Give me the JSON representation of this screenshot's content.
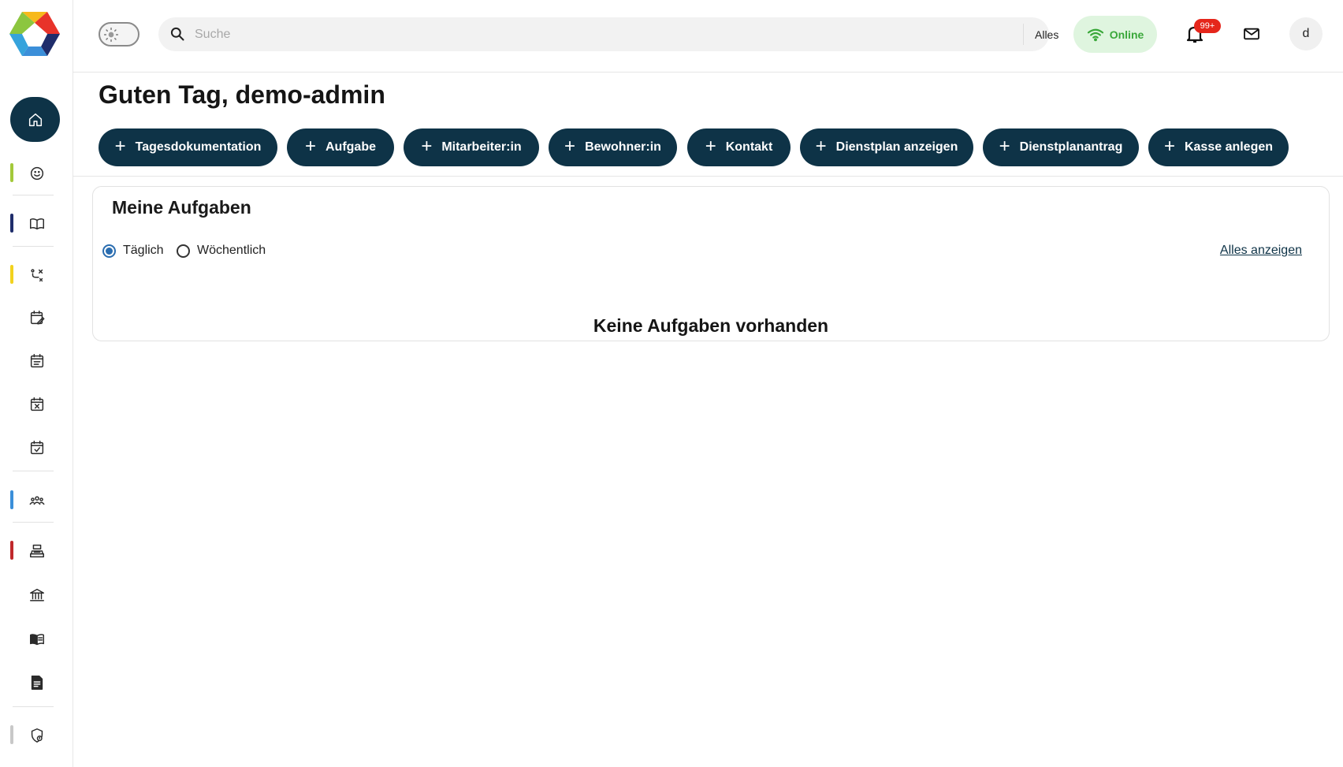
{
  "sidebar": {
    "accent_colors": {
      "residents": "#a3c93a",
      "documentation": "#1f2d6b",
      "care_planning": "#f2d21e",
      "staff": "#3b8fd9",
      "cashbox": "#c0282b",
      "admin": "#c8c8c8"
    },
    "items": [
      {
        "icon": "home-icon"
      },
      {
        "icon": "smiley-icon"
      },
      {
        "icon": "open-book-icon"
      },
      {
        "icon": "route-icon"
      },
      {
        "icon": "calendar-edit-icon"
      },
      {
        "icon": "calendar-list-icon"
      },
      {
        "icon": "calendar-cross-icon"
      },
      {
        "icon": "calendar-check-icon"
      },
      {
        "icon": "group-icon"
      },
      {
        "icon": "cash-register-icon"
      },
      {
        "icon": "bank-icon"
      },
      {
        "icon": "manual-book-icon"
      },
      {
        "icon": "document-icon"
      },
      {
        "icon": "shield-lock-icon"
      }
    ]
  },
  "header": {
    "search": {
      "placeholder": "Suche",
      "scope": "Alles"
    },
    "status": {
      "label": "Online",
      "color": "#3aa83a"
    },
    "notifications": {
      "badge": "99+"
    },
    "avatar": {
      "initial": "d"
    }
  },
  "main": {
    "greeting": "Guten Tag, demo-admin",
    "quick_actions": [
      {
        "label": "Tagesdokumentation"
      },
      {
        "label": "Aufgabe"
      },
      {
        "label": "Mitarbeiter:in"
      },
      {
        "label": "Bewohner:in"
      },
      {
        "label": "Kontakt"
      },
      {
        "label": "Dienstplan anzeigen"
      },
      {
        "label": "Dienstplanantrag"
      },
      {
        "label": "Kasse anlegen"
      }
    ],
    "tasks": {
      "title": "Meine Aufgaben",
      "filters": [
        {
          "label": "Täglich",
          "selected": true
        },
        {
          "label": "Wöchentlich",
          "selected": false
        }
      ],
      "show_all": "Alles anzeigen",
      "empty_message": "Keine Aufgaben vorhanden"
    }
  },
  "colors": {
    "primary": "#0e3347",
    "accent": "#2a6db0",
    "badge": "#e5261b"
  }
}
